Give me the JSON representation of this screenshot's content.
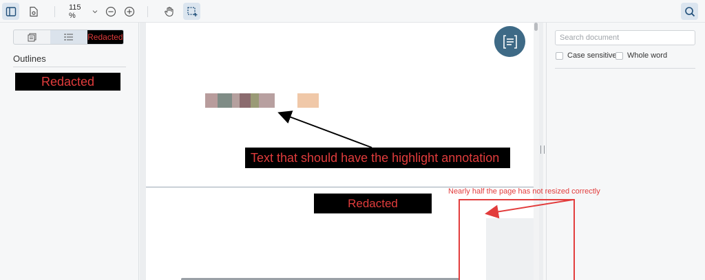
{
  "toolbar": {
    "zoom_value": "115 %",
    "icons": {
      "sidebar_toggle": "sidebar-toggle-icon",
      "document_settings": "document-gear-icon",
      "zoom_out": "zoom-out-icon",
      "zoom_in": "zoom-in-icon",
      "pan": "hand-icon",
      "select": "marquee-select-icon",
      "search": "search-icon"
    }
  },
  "left_panel": {
    "tabs": [
      "thumbnails-icon",
      "outline-list-icon",
      "Redacted"
    ],
    "redacted_tab_label": "Redacted",
    "outlines_title": "Outlines",
    "outline_item_redacted": "Redacted"
  },
  "document": {
    "annotation_label": "Text that should have the highlight annotation",
    "page2_redacted": "Redacted",
    "note": "Nearly half the page has not resized correctly",
    "fab_icon": "text-lines-icon",
    "swatches": [
      "#b89c9c",
      "#7f8c86",
      "#b5a09e",
      "#8b6b6e",
      "#9a9a76",
      "#b8a0a0",
      "#f0c8a8"
    ]
  },
  "right_panel": {
    "search_placeholder": "Search document",
    "case_sensitive": "Case sensitive",
    "whole_word": "Whole word"
  },
  "colors": {
    "accent": "#3e6a86",
    "annotation_red": "#e23c3c"
  }
}
